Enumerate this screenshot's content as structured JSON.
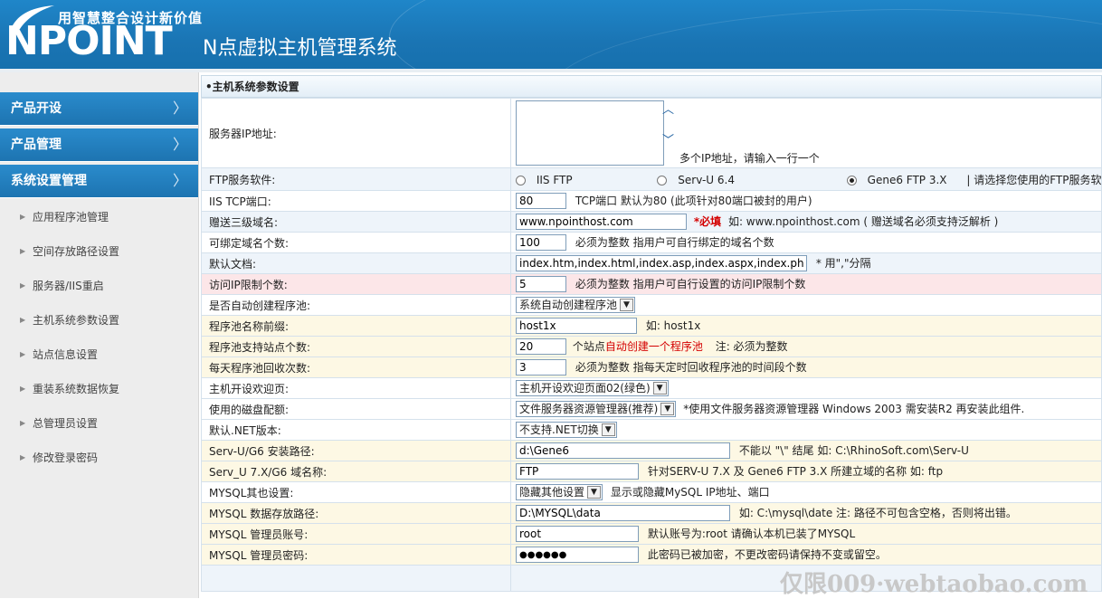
{
  "header": {
    "slogan": "用智慧整合设计新价值",
    "logo": "NPOINT",
    "system_title": "N点虚拟主机管理系统"
  },
  "sidebar": {
    "main_items": [
      {
        "label": "产品开设"
      },
      {
        "label": "产品管理"
      },
      {
        "label": "系统设置管理"
      }
    ],
    "sub_items": [
      {
        "label": "应用程序池管理"
      },
      {
        "label": "空间存放路径设置"
      },
      {
        "label": "服务器/IIS重启"
      },
      {
        "label": "主机系统参数设置"
      },
      {
        "label": "站点信息设置"
      },
      {
        "label": "重装系统数据恢复"
      },
      {
        "label": "总管理员设置"
      },
      {
        "label": "修改登录密码"
      }
    ]
  },
  "panel": {
    "title": "•主机系统参数设置"
  },
  "form": {
    "server_ip": {
      "label": "服务器IP地址:",
      "note": "多个IP地址，请输入一行一个"
    },
    "ftp_software": {
      "label": "FTP服务软件:",
      "options": [
        "IIS FTP",
        "Serv-U 6.4",
        "Gene6 FTP 3.X"
      ],
      "selected": "Gene6 FTP 3.X",
      "note": "| 请选择您使用的FTP服务软件."
    },
    "iis_port": {
      "label": "IIS TCP端口:",
      "value": "80",
      "note": "TCP端口 默认为80 (此项针对80端口被封的用户)"
    },
    "gift_domain": {
      "label": "赠送三级域名:",
      "value": "www.npointhost.com",
      "required": "*必填",
      "note": "如: www.npointhost.com ( 赠送域名必须支持泛解析 )"
    },
    "bind_count": {
      "label": "可绑定域名个数:",
      "value": "100",
      "note": "必须为整数 指用户可自行绑定的域名个数"
    },
    "default_doc": {
      "label": "默认文档:",
      "value": "index.htm,index.html,index.asp,index.aspx,index.php",
      "note": "* 用\",\"分隔"
    },
    "ip_limit": {
      "label": "访问IP限制个数:",
      "value": "5",
      "note": "必须为整数 指用户可自行设置的访问IP限制个数"
    },
    "auto_pool": {
      "label": "是否自动创建程序池:",
      "value": "系统自动创建程序池"
    },
    "pool_prefix": {
      "label": "程序池名称前缀:",
      "value": "host1x",
      "note": "如: host1x"
    },
    "pool_sites": {
      "label": "程序池支持站点个数:",
      "value": "20",
      "note_a": "个站点",
      "note_red": "自动创建一个程序池",
      "note_b": "注: 必须为整数"
    },
    "pool_recycle": {
      "label": "每天程序池回收次数:",
      "value": "3",
      "note": "必须为整数 指每天定时回收程序池的时间段个数"
    },
    "welcome_page": {
      "label": "主机开设欢迎页:",
      "value": "主机开设欢迎页面02(绿色)"
    },
    "disk_config": {
      "label": "使用的磁盘配额:",
      "value": "文件服务器资源管理器(推荐)",
      "note": "*使用文件服务器资源管理器 Windows 2003 需安装R2 再安装此组件."
    },
    "dotnet": {
      "label": "默认.NET版本:",
      "value": "不支持.NET切换"
    },
    "servu_path": {
      "label": "Serv-U/G6 安装路径:",
      "value": "d:\\Gene6",
      "note": "不能以 \"\\\" 结尾 如: C:\\RhinoSoft.com\\Serv-U"
    },
    "servu_domain": {
      "label": "Serv_U 7.X/G6 域名称:",
      "value": "FTP",
      "note": "针对SERV-U 7.X 及 Gene6 FTP 3.X 所建立域的名称 如: ftp"
    },
    "mysql_other": {
      "label": "MYSQL其也设置:",
      "value": "隐藏其他设置",
      "note": "显示或隐藏MySQL IP地址、端口"
    },
    "mysql_path": {
      "label": "MYSQL 数据存放路径:",
      "value": "D:\\MYSQL\\data",
      "note": "如: C:\\mysql\\date 注: 路径不可包含空格，否则将出错。"
    },
    "mysql_user": {
      "label": "MYSQL 管理员账号:",
      "value": "root",
      "note": "默认账号为:root 请确认本机已装了MYSQL"
    },
    "mysql_pass": {
      "label": "MYSQL 管理员密码:",
      "value": "●●●●●●",
      "note": "此密码已被加密，不更改密码请保持不变或留空。"
    }
  },
  "watermark": "仅限009·webtaobao.com"
}
